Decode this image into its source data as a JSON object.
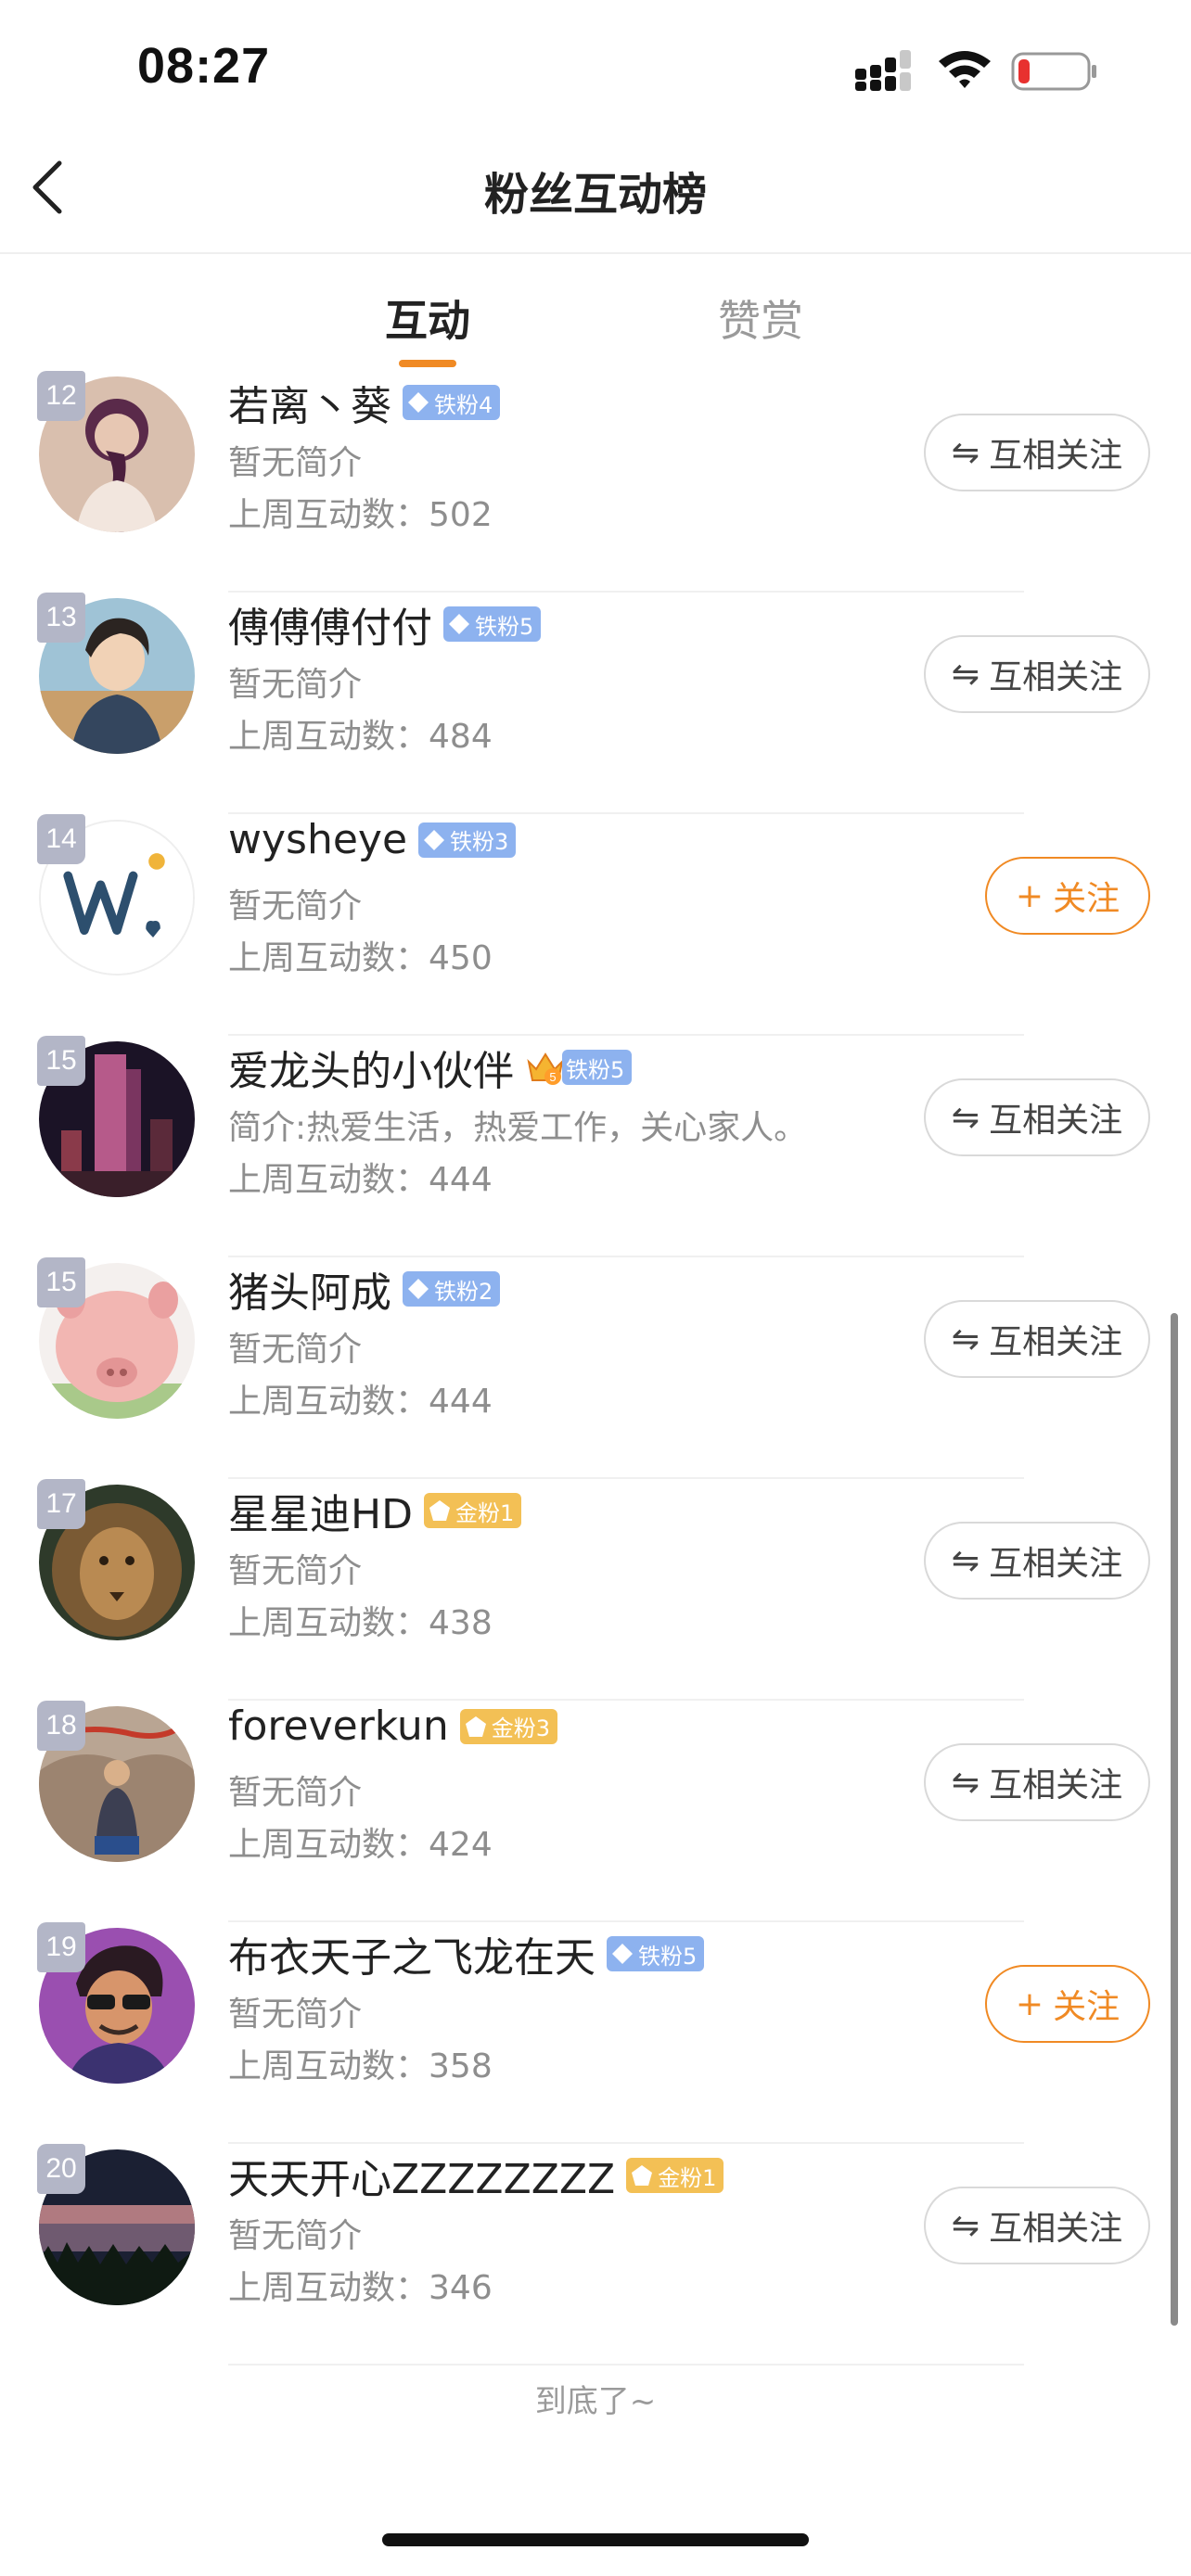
{
  "status_bar": {
    "time": "08:27"
  },
  "header": {
    "title": "粉丝互动榜"
  },
  "tabs": [
    {
      "label": "互动",
      "active": true
    },
    {
      "label": "赞赏",
      "active": false
    }
  ],
  "count_label": "上周互动数：",
  "fans": [
    {
      "rank": "12",
      "name": "若离丶葵",
      "level": "铁粉4",
      "level_type": "iron",
      "crown": false,
      "bio": "暂无简介",
      "count": "502",
      "button": "互相关注",
      "button_type": "mutual",
      "avatar_icon": "braided-hair-girl"
    },
    {
      "rank": "13",
      "name": "傅傅傅付付",
      "level": "铁粉5",
      "level_type": "iron",
      "crown": false,
      "bio": "暂无简介",
      "count": "484",
      "button": "互相关注",
      "button_type": "mutual",
      "avatar_icon": "anime-boy"
    },
    {
      "rank": "14",
      "name": "wysheye",
      "level": "铁粉3",
      "level_type": "iron",
      "crown": false,
      "bio": "暂无简介",
      "count": "450",
      "button": "关注",
      "button_type": "follow",
      "avatar_icon": "letter-w-sun"
    },
    {
      "rank": "15",
      "name": "爱龙头的小伙伴",
      "level": "铁粉5",
      "level_type": "iron",
      "crown": true,
      "bio": "简介:热爱生活，热爱工作，关心家人。",
      "count": "444",
      "button": "互相关注",
      "button_type": "mutual",
      "avatar_icon": "night-skyscraper"
    },
    {
      "rank": "15",
      "name": "猪头阿成",
      "level": "铁粉2",
      "level_type": "iron",
      "crown": false,
      "bio": "暂无简介",
      "count": "444",
      "button": "互相关注",
      "button_type": "mutual",
      "avatar_icon": "pink-pig"
    },
    {
      "rank": "17",
      "name": "星星迪HD",
      "level": "金粉1",
      "level_type": "gold",
      "crown": false,
      "bio": "暂无简介",
      "count": "438",
      "button": "互相关注",
      "button_type": "mutual",
      "avatar_icon": "lion"
    },
    {
      "rank": "18",
      "name": "foreverkun",
      "level": "金粉3",
      "level_type": "gold",
      "crown": false,
      "bio": "暂无简介",
      "count": "424",
      "button": "互相关注",
      "button_type": "mutual",
      "avatar_icon": "man-on-rock"
    },
    {
      "rank": "19",
      "name": "布衣天子之飞龙在天",
      "level": "铁粉5",
      "level_type": "iron",
      "crown": false,
      "bio": "暂无简介",
      "count": "358",
      "button": "关注",
      "button_type": "follow",
      "avatar_icon": "cartoon-man-sunglasses"
    },
    {
      "rank": "20",
      "name": "天天开心ZZZZZZZZ",
      "level": "金粉1",
      "level_type": "gold",
      "crown": false,
      "bio": "暂无简介",
      "count": "346",
      "button": "互相关注",
      "button_type": "mutual",
      "avatar_icon": "forest-sunset"
    }
  ],
  "end_text": "到底了~",
  "colors": {
    "accent": "#f08a24",
    "iron_badge": "#8db2ef",
    "gold_badge": "#f3c055",
    "rank_badge": "#b3b6c7",
    "muted_text": "#8e8e8e"
  }
}
